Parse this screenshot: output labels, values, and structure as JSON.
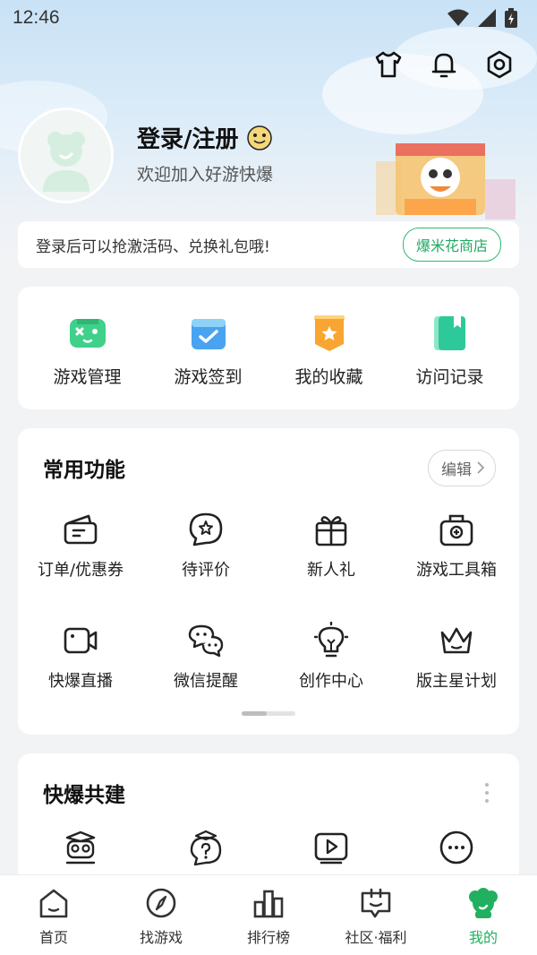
{
  "status_bar": {
    "time": "12:46"
  },
  "top_icons": [
    "tshirt-icon",
    "bell-icon",
    "settings-hexagon-icon"
  ],
  "profile": {
    "title": "登录/注册",
    "subtitle": "欢迎加入好游快爆"
  },
  "banner": {
    "text": "登录后可以抢激活码、兑换礼包哦!",
    "shop_button": "爆米花商店"
  },
  "quick_actions": [
    {
      "label": "游戏管理",
      "icon": "gamepad-icon"
    },
    {
      "label": "游戏签到",
      "icon": "calendar-check-icon"
    },
    {
      "label": "我的收藏",
      "icon": "star-bookmark-icon"
    },
    {
      "label": "访问记录",
      "icon": "history-book-icon"
    }
  ],
  "common_functions": {
    "title": "常用功能",
    "edit_label": "编辑",
    "items": [
      {
        "label": "订单/优惠券",
        "icon": "wallet-icon"
      },
      {
        "label": "待评价",
        "icon": "star-chat-icon"
      },
      {
        "label": "新人礼",
        "icon": "gift-icon"
      },
      {
        "label": "游戏工具箱",
        "icon": "toolbox-icon"
      },
      {
        "label": "快爆直播",
        "icon": "video-camera-icon"
      },
      {
        "label": "微信提醒",
        "icon": "wechat-icon"
      },
      {
        "label": "创作中心",
        "icon": "lightbulb-icon"
      },
      {
        "label": "版主星计划",
        "icon": "crown-icon"
      }
    ]
  },
  "co_build": {
    "title": "快爆共建",
    "icons": [
      "owl-icon",
      "question-bubble-icon",
      "play-video-icon",
      "more-circle-icon"
    ]
  },
  "tabbar": [
    {
      "label": "首页",
      "icon": "home-icon",
      "active": false
    },
    {
      "label": "找游戏",
      "icon": "compass-icon",
      "active": false
    },
    {
      "label": "排行榜",
      "icon": "bar-chart-icon",
      "active": false
    },
    {
      "label": "社区·福利",
      "icon": "community-icon",
      "active": false
    },
    {
      "label": "我的",
      "icon": "profile-mascot-icon",
      "active": true
    }
  ],
  "colors": {
    "accent": "#20b060",
    "background": "#f2f3f5",
    "card": "#ffffff"
  }
}
